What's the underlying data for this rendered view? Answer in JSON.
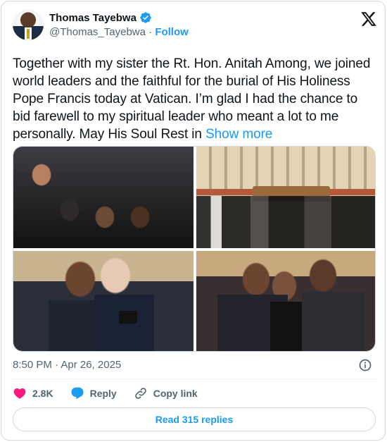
{
  "author": {
    "name": "Thomas Tayebwa",
    "handle": "@Thomas_Tayebwa",
    "separator": " · ",
    "follow_label": "Follow"
  },
  "post": {
    "text": "Together with my sister the Rt. Hon. Anitah Among, we joined world leaders and the faithful for the burial of His Holiness Pope Francis today at Vatican. I’m glad I had the chance to bid farewell to my spiritual leader who meant a lot to me personally. May His Soul Rest in ",
    "show_more_label": "Show more",
    "timestamp": "8:50 PM · Apr 26, 2025"
  },
  "actions": {
    "likes": "2.8K",
    "reply_label": "Reply",
    "copy_link_label": "Copy link"
  },
  "read_replies_label": "Read 315 replies",
  "colors": {
    "accent": "#1d9bf0",
    "like": "#f91880",
    "secondary_text": "#536471",
    "border": "#cfd9de"
  },
  "icons": [
    "verified-badge-icon",
    "x-logo-icon",
    "info-icon",
    "heart-icon",
    "reply-icon",
    "copy-link-icon"
  ]
}
